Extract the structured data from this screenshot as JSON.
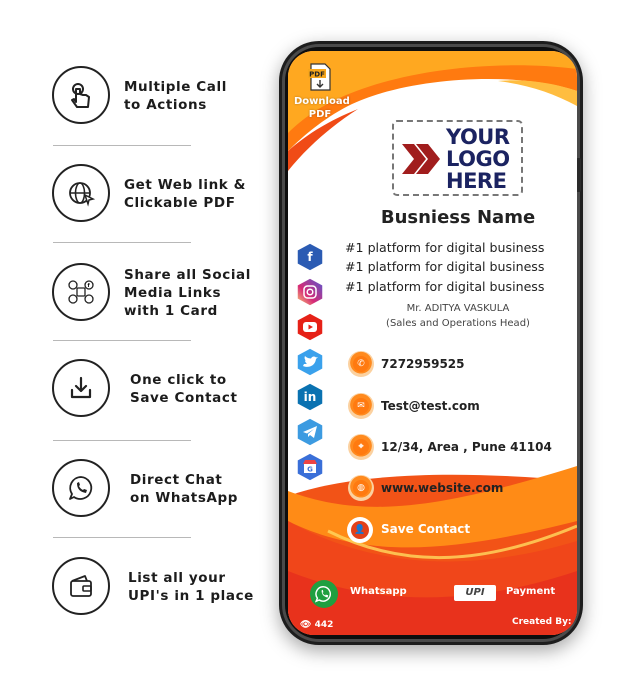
{
  "features": [
    {
      "icon": "touch-hand-icon",
      "line1": "Multiple Call",
      "line2": "to Actions"
    },
    {
      "icon": "globe-cursor-icon",
      "line1": "Get Web link &",
      "line2": "Clickable PDF"
    },
    {
      "icon": "social-media-icon",
      "line1": "Share all Social",
      "line2": "Media Links",
      "line3": "with 1 Card"
    },
    {
      "icon": "download-icon",
      "line1": "One click to",
      "line2": "Save Contact"
    },
    {
      "icon": "whatsapp-icon",
      "line1": "Direct Chat",
      "line2": "on WhatsApp"
    },
    {
      "icon": "wallet-icon",
      "line1": "List all your",
      "line2": "UPI's in 1 place"
    }
  ],
  "card": {
    "pdf_badge": "PDF",
    "download_label": "Download",
    "download_label2": "PDF",
    "logo_lines": [
      "YOUR",
      "LOGO",
      "HERE"
    ],
    "business_name": "Busniess Name",
    "taglines": [
      "#1 platform for digital business",
      "#1 platform for digital business",
      "#1 platform for digital business"
    ],
    "person_name": "Mr. ADITYA VASKULA",
    "person_title": "(Sales and Operations Head)",
    "social": [
      {
        "name": "facebook",
        "glyph": "f",
        "color": "#2b5bb3"
      },
      {
        "name": "instagram",
        "glyph": "◎",
        "color": "#c13584"
      },
      {
        "name": "youtube",
        "glyph": "▶",
        "color": "#e62117"
      },
      {
        "name": "twitter",
        "glyph": "🐦",
        "color": "#3aa1ec"
      },
      {
        "name": "linkedin",
        "glyph": "in",
        "color": "#0a72b1"
      },
      {
        "name": "telegram",
        "glyph": "➤",
        "color": "#3c9be1"
      },
      {
        "name": "google-business",
        "glyph": "G",
        "color": "#3a6fd8"
      }
    ],
    "contacts": {
      "phone": "7272959525",
      "email": "Test@test.com",
      "address": "12/34, Area , Pune 41104",
      "website": "www.website.com"
    },
    "save_contact": "Save Contact",
    "whatsapp_label": "Whatsapp",
    "upi_badge": "UPI",
    "payment_label": "Payment",
    "views": "442",
    "created_by": "Created By: A"
  },
  "colors": {
    "orange": "#ff7a10",
    "red_orange": "#f04b16",
    "navy": "#1b2361",
    "logo_red": "#a11d1d"
  }
}
